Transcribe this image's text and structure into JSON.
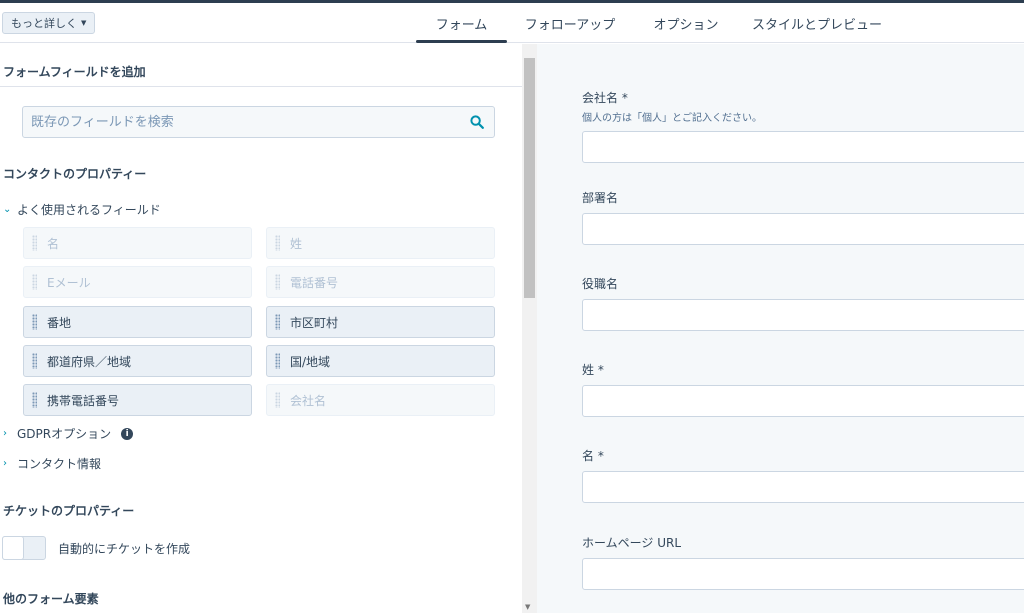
{
  "topbar": {
    "more_button": "もっと詳しく",
    "tabs": [
      {
        "label": "フォーム",
        "active": true
      },
      {
        "label": "フォローアップ",
        "active": false
      },
      {
        "label": "オプション",
        "active": false
      },
      {
        "label": "スタイルとプレビュー",
        "active": false
      }
    ]
  },
  "sidebar": {
    "add_field_title": "フォームフィールドを追加",
    "search": {
      "placeholder": "既存のフィールドを検索",
      "value": ""
    },
    "contact_props_title": "コンタクトのプロパティー",
    "groups": {
      "common": {
        "label": "よく使用されるフィールド",
        "expanded": true
      },
      "gdpr": {
        "label": "GDPRオプション",
        "expanded": false
      },
      "contact_info": {
        "label": "コンタクト情報",
        "expanded": false
      }
    },
    "fields": [
      {
        "label": "名",
        "enabled": false
      },
      {
        "label": "姓",
        "enabled": false
      },
      {
        "label": "Eメール",
        "enabled": false
      },
      {
        "label": "電話番号",
        "enabled": false
      },
      {
        "label": "番地",
        "enabled": true
      },
      {
        "label": "市区町村",
        "enabled": true
      },
      {
        "label": "都道府県／地域",
        "enabled": true
      },
      {
        "label": "国/地域",
        "enabled": true
      },
      {
        "label": "携帯電話番号",
        "enabled": true
      },
      {
        "label": "会社名",
        "enabled": false
      }
    ],
    "ticket_props_title": "チケットのプロパティー",
    "auto_ticket_label": "自動的にチケットを作成",
    "auto_ticket_on": false,
    "other_elements_title": "他のフォーム要素"
  },
  "form_preview": {
    "fields": [
      {
        "label": "会社名 *",
        "help": "個人の方は「個人」とご記入ください。"
      },
      {
        "label": "部署名"
      },
      {
        "label": "役職名"
      },
      {
        "label": "姓 *"
      },
      {
        "label": "名 *"
      },
      {
        "label": "ホームページ URL"
      }
    ]
  },
  "colors": {
    "accent": "#0091ae",
    "text": "#33475b",
    "border": "#cbd6e2",
    "field_bg": "#eaf0f6",
    "preview_bg": "#f5f8fa"
  }
}
